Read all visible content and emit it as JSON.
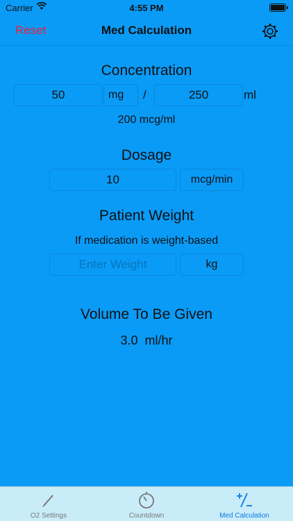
{
  "status_bar": {
    "carrier": "Carrier",
    "time": "4:55 PM"
  },
  "nav": {
    "reset_label": "Reset",
    "title": "Med Calculation",
    "settings_icon": "gear-icon"
  },
  "concentration": {
    "title": "Concentration",
    "amount_value": "50",
    "amount_unit": "mg",
    "separator": "/",
    "volume_value": "250",
    "volume_unit": "ml",
    "result": "200 mcg/ml"
  },
  "dosage": {
    "title": "Dosage",
    "value": "10",
    "unit": "mcg/min"
  },
  "patient_weight": {
    "title": "Patient Weight",
    "subtitle": "If medication is weight-based",
    "placeholder": "Enter Weight",
    "unit": "kg"
  },
  "result": {
    "title": "Volume To Be Given",
    "value": "3.0  ml/hr"
  },
  "tabs": [
    {
      "label": "O2 Settings",
      "icon": "pencil-icon"
    },
    {
      "label": "Countdown",
      "icon": "timer-icon"
    },
    {
      "label": "Med Calculation",
      "icon": "plus-minus-icon",
      "active": true
    }
  ],
  "colors": {
    "background": "#0a9bf7",
    "accent_red": "#e8213a",
    "tab_active": "#0a7be0",
    "tab_bar": "#c9ecf9"
  }
}
